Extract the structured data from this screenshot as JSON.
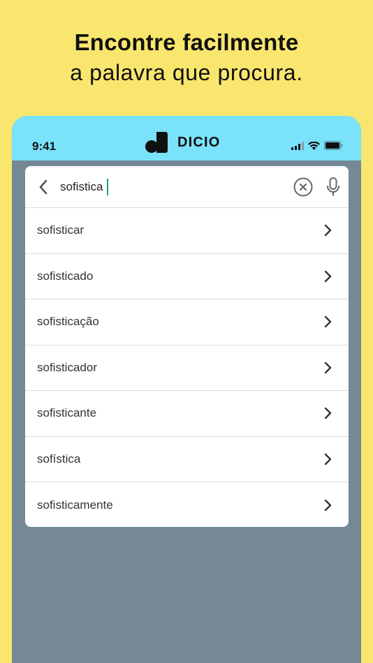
{
  "promo": {
    "line1": "Encontre facilmente",
    "line2": "a palavra que procura."
  },
  "status_bar": {
    "time": "9:41",
    "icons": [
      "signal-icon",
      "wifi-icon",
      "battery-icon"
    ]
  },
  "app": {
    "name": "DICIO",
    "accent": "#7AE2FB",
    "background": "#F9E66E",
    "caret_color": "#1E9E8E"
  },
  "search": {
    "value": "sofistica",
    "icons": [
      "back-arrow-icon",
      "clear-circle-icon",
      "microphone-icon"
    ]
  },
  "results": [
    {
      "label": "sofisticar"
    },
    {
      "label": "sofisticado"
    },
    {
      "label": "sofisticação"
    },
    {
      "label": "sofisticador"
    },
    {
      "label": "sofisticante"
    },
    {
      "label": "sofística"
    },
    {
      "label": "sofisticamente"
    }
  ]
}
